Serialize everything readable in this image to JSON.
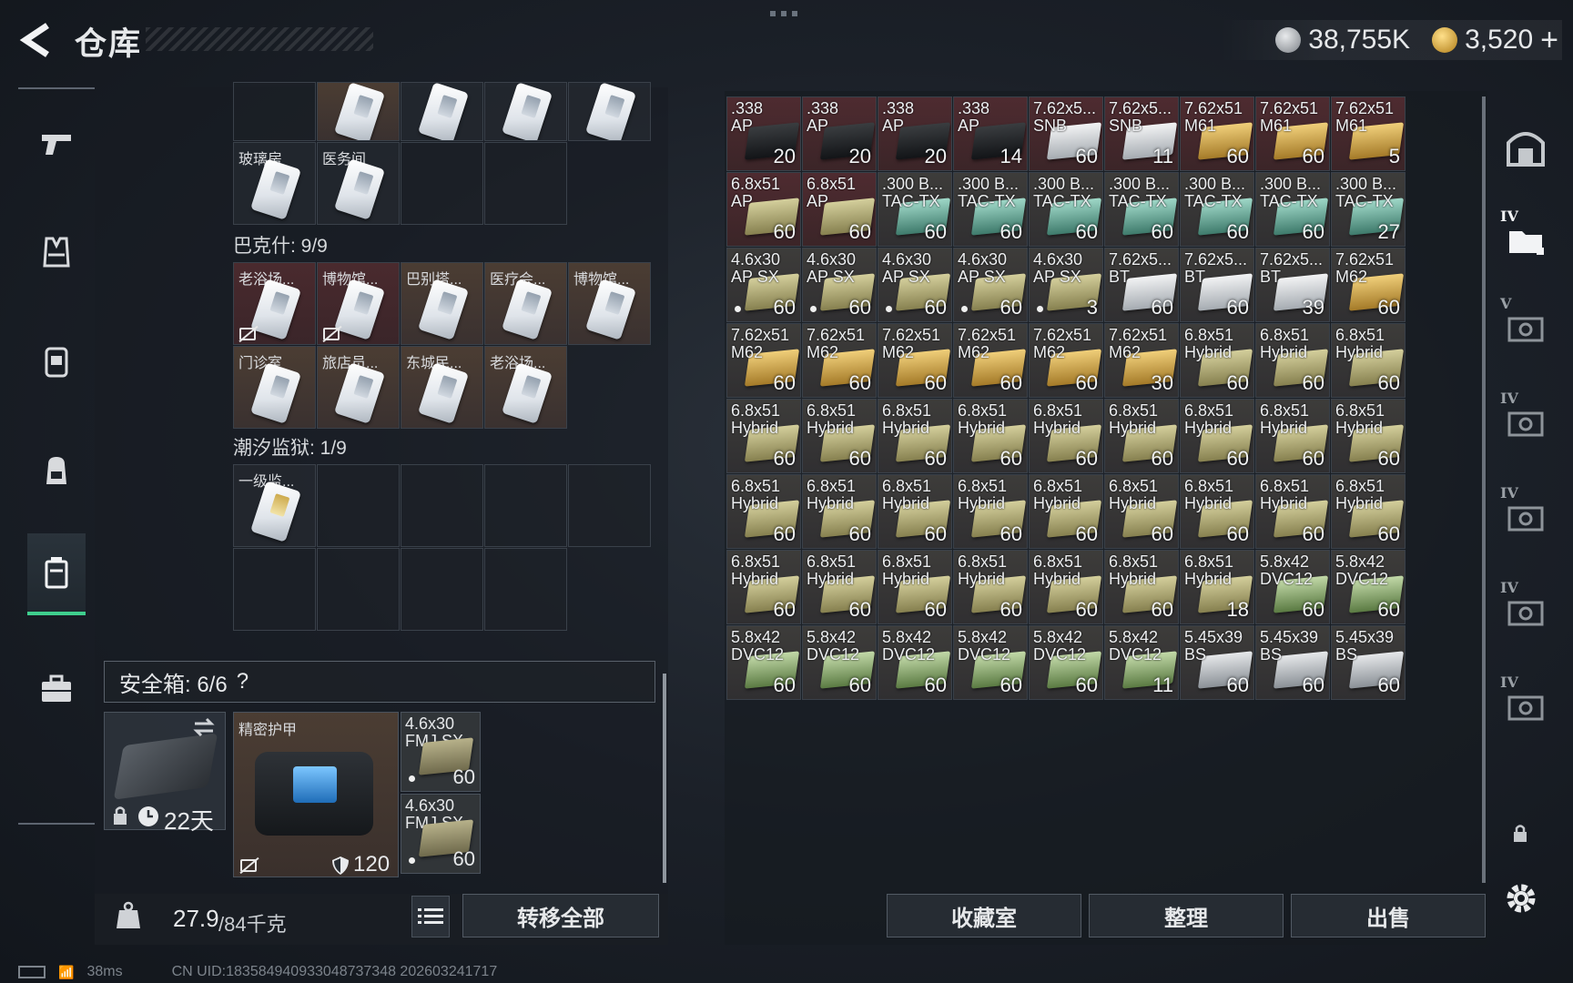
{
  "header": {
    "title": "仓库",
    "currency": [
      {
        "name": "silver-coin",
        "value": "38,755K",
        "color": "#c7cacd"
      },
      {
        "name": "gold-coin",
        "value": "3,520",
        "color": "#e0a93a"
      }
    ],
    "add_label": "+"
  },
  "left_rail": {
    "items": [
      {
        "icon": "pistol-icon"
      },
      {
        "icon": "vest-icon"
      },
      {
        "icon": "helmet-icon"
      },
      {
        "icon": "backpack-icon"
      },
      {
        "icon": "container-icon",
        "active": true
      },
      {
        "icon": "briefcase-icon"
      }
    ]
  },
  "key_cases": {
    "top_cards": [
      "",
      "",
      "",
      ""
    ],
    "row_a": [
      "玻璃房",
      "医务间"
    ],
    "bakesh_title": "巴克什: 9/9",
    "bakesh_row1": [
      "老浴场...",
      "博物馆...",
      "巴别塔...",
      "医疗会...",
      "博物馆..."
    ],
    "bakesh_row2": [
      "门诊室",
      "旅店员...",
      "东城民...",
      "老浴场..."
    ],
    "prison_title": "潮汐监狱: 1/9",
    "prison_items": [
      "一级监..."
    ]
  },
  "secure_box": {
    "label": "安全箱: 6/6",
    "help": "?",
    "case_days": "22天",
    "armor_name": "精密护甲",
    "armor_value": "120",
    "ammo": [
      {
        "l1": "4.6x30",
        "l2": "FMJ SX",
        "qty": "60"
      },
      {
        "l1": "4.6x30",
        "l2": "FMJ SX",
        "qty": "60"
      }
    ]
  },
  "weight": {
    "current": "27.9",
    "max": "/84千克"
  },
  "transfer_all": "转移全部",
  "inventory": [
    {
      "l1": ".338",
      "l2": "AP",
      "q": "20",
      "bg": "red",
      "box": "dark"
    },
    {
      "l1": ".338",
      "l2": "AP",
      "q": "20",
      "bg": "red",
      "box": "dark"
    },
    {
      "l1": ".338",
      "l2": "AP",
      "q": "20",
      "bg": "red",
      "box": "dark"
    },
    {
      "l1": ".338",
      "l2": "AP",
      "q": "14",
      "bg": "red",
      "box": "dark"
    },
    {
      "l1": "7.62x5...",
      "l2": "SNB",
      "q": "60",
      "bg": "red",
      "box": "white"
    },
    {
      "l1": "7.62x5...",
      "l2": "SNB",
      "q": "11",
      "bg": "red",
      "box": "white"
    },
    {
      "l1": "7.62x51",
      "l2": "M61",
      "q": "60",
      "bg": "red",
      "box": "gold"
    },
    {
      "l1": "7.62x51",
      "l2": "M61",
      "q": "60",
      "bg": "red",
      "box": "gold"
    },
    {
      "l1": "7.62x51",
      "l2": "M61",
      "q": "5",
      "bg": "red",
      "box": "gold"
    },
    {
      "l1": "6.8x51",
      "l2": "AP",
      "q": "60",
      "bg": "red",
      "box": "khaki"
    },
    {
      "l1": "6.8x51",
      "l2": "AP",
      "q": "60",
      "bg": "red",
      "box": "khaki"
    },
    {
      "l1": ".300 B...",
      "l2": "TAC-TX",
      "q": "60",
      "bg": "grey",
      "box": "teal"
    },
    {
      "l1": ".300 B...",
      "l2": "TAC-TX",
      "q": "60",
      "bg": "grey",
      "box": "teal"
    },
    {
      "l1": ".300 B...",
      "l2": "TAC-TX",
      "q": "60",
      "bg": "grey",
      "box": "teal"
    },
    {
      "l1": ".300 B...",
      "l2": "TAC-TX",
      "q": "60",
      "bg": "grey",
      "box": "teal"
    },
    {
      "l1": ".300 B...",
      "l2": "TAC-TX",
      "q": "60",
      "bg": "grey",
      "box": "teal"
    },
    {
      "l1": ".300 B...",
      "l2": "TAC-TX",
      "q": "60",
      "bg": "grey",
      "box": "teal"
    },
    {
      "l1": ".300 B...",
      "l2": "TAC-TX",
      "q": "27",
      "bg": "grey",
      "box": "teal"
    },
    {
      "l1": "4.6x30",
      "l2": "AP SX",
      "q": "60",
      "bg": "grey",
      "box": "khaki",
      "dot": true
    },
    {
      "l1": "4.6x30",
      "l2": "AP SX",
      "q": "60",
      "bg": "grey",
      "box": "khaki",
      "dot": true
    },
    {
      "l1": "4.6x30",
      "l2": "AP SX",
      "q": "60",
      "bg": "grey",
      "box": "khaki",
      "dot": true
    },
    {
      "l1": "4.6x30",
      "l2": "AP SX",
      "q": "60",
      "bg": "grey",
      "box": "khaki",
      "dot": true
    },
    {
      "l1": "4.6x30",
      "l2": "AP SX",
      "q": "3",
      "bg": "grey",
      "box": "khaki",
      "dot": true
    },
    {
      "l1": "7.62x5...",
      "l2": "BT",
      "q": "60",
      "bg": "grey",
      "box": "white"
    },
    {
      "l1": "7.62x5...",
      "l2": "BT",
      "q": "60",
      "bg": "grey",
      "box": "white"
    },
    {
      "l1": "7.62x5...",
      "l2": "BT",
      "q": "39",
      "bg": "grey",
      "box": "white"
    },
    {
      "l1": "7.62x51",
      "l2": "M62",
      "q": "60",
      "bg": "grey",
      "box": "gold"
    },
    {
      "l1": "7.62x51",
      "l2": "M62",
      "q": "60",
      "bg": "grey",
      "box": "gold"
    },
    {
      "l1": "7.62x51",
      "l2": "M62",
      "q": "60",
      "bg": "grey",
      "box": "gold"
    },
    {
      "l1": "7.62x51",
      "l2": "M62",
      "q": "60",
      "bg": "grey",
      "box": "gold"
    },
    {
      "l1": "7.62x51",
      "l2": "M62",
      "q": "60",
      "bg": "grey",
      "box": "gold"
    },
    {
      "l1": "7.62x51",
      "l2": "M62",
      "q": "60",
      "bg": "grey",
      "box": "gold"
    },
    {
      "l1": "7.62x51",
      "l2": "M62",
      "q": "30",
      "bg": "grey",
      "box": "gold"
    },
    {
      "l1": "6.8x51",
      "l2": "Hybrid",
      "q": "60",
      "bg": "grey",
      "box": "khaki"
    },
    {
      "l1": "6.8x51",
      "l2": "Hybrid",
      "q": "60",
      "bg": "grey",
      "box": "khaki"
    },
    {
      "l1": "6.8x51",
      "l2": "Hybrid",
      "q": "60",
      "bg": "grey",
      "box": "khaki"
    },
    {
      "l1": "6.8x51",
      "l2": "Hybrid",
      "q": "60",
      "bg": "grey",
      "box": "khaki"
    },
    {
      "l1": "6.8x51",
      "l2": "Hybrid",
      "q": "60",
      "bg": "grey",
      "box": "khaki"
    },
    {
      "l1": "6.8x51",
      "l2": "Hybrid",
      "q": "60",
      "bg": "grey",
      "box": "khaki"
    },
    {
      "l1": "6.8x51",
      "l2": "Hybrid",
      "q": "60",
      "bg": "grey",
      "box": "khaki"
    },
    {
      "l1": "6.8x51",
      "l2": "Hybrid",
      "q": "60",
      "bg": "grey",
      "box": "khaki"
    },
    {
      "l1": "6.8x51",
      "l2": "Hybrid",
      "q": "60",
      "bg": "grey",
      "box": "khaki"
    },
    {
      "l1": "6.8x51",
      "l2": "Hybrid",
      "q": "60",
      "bg": "grey",
      "box": "khaki"
    },
    {
      "l1": "6.8x51",
      "l2": "Hybrid",
      "q": "60",
      "bg": "grey",
      "box": "khaki"
    },
    {
      "l1": "6.8x51",
      "l2": "Hybrid",
      "q": "60",
      "bg": "grey",
      "box": "khaki"
    },
    {
      "l1": "6.8x51",
      "l2": "Hybrid",
      "q": "60",
      "bg": "grey",
      "box": "khaki"
    },
    {
      "l1": "6.8x51",
      "l2": "Hybrid",
      "q": "60",
      "bg": "grey",
      "box": "khaki"
    },
    {
      "l1": "6.8x51",
      "l2": "Hybrid",
      "q": "60",
      "bg": "grey",
      "box": "khaki"
    },
    {
      "l1": "6.8x51",
      "l2": "Hybrid",
      "q": "60",
      "bg": "grey",
      "box": "khaki"
    },
    {
      "l1": "6.8x51",
      "l2": "Hybrid",
      "q": "60",
      "bg": "grey",
      "box": "khaki"
    },
    {
      "l1": "6.8x51",
      "l2": "Hybrid",
      "q": "60",
      "bg": "grey",
      "box": "khaki"
    },
    {
      "l1": "6.8x51",
      "l2": "Hybrid",
      "q": "60",
      "bg": "grey",
      "box": "khaki"
    },
    {
      "l1": "6.8x51",
      "l2": "Hybrid",
      "q": "60",
      "bg": "grey",
      "box": "khaki"
    },
    {
      "l1": "6.8x51",
      "l2": "Hybrid",
      "q": "60",
      "bg": "grey",
      "box": "khaki"
    },
    {
      "l1": "6.8x51",
      "l2": "Hybrid",
      "q": "60",
      "bg": "grey",
      "box": "khaki"
    },
    {
      "l1": "6.8x51",
      "l2": "Hybrid",
      "q": "60",
      "bg": "grey",
      "box": "khaki"
    },
    {
      "l1": "6.8x51",
      "l2": "Hybrid",
      "q": "60",
      "bg": "grey",
      "box": "khaki"
    },
    {
      "l1": "6.8x51",
      "l2": "Hybrid",
      "q": "60",
      "bg": "grey",
      "box": "khaki"
    },
    {
      "l1": "6.8x51",
      "l2": "Hybrid",
      "q": "60",
      "bg": "grey",
      "box": "khaki"
    },
    {
      "l1": "6.8x51",
      "l2": "Hybrid",
      "q": "60",
      "bg": "grey",
      "box": "khaki"
    },
    {
      "l1": "6.8x51",
      "l2": "Hybrid",
      "q": "18",
      "bg": "grey",
      "box": "khaki"
    },
    {
      "l1": "5.8x42",
      "l2": "DVC12",
      "q": "60",
      "bg": "grey",
      "box": "green"
    },
    {
      "l1": "5.8x42",
      "l2": "DVC12",
      "q": "60",
      "bg": "grey",
      "box": "green"
    },
    {
      "l1": "5.8x42",
      "l2": "DVC12",
      "q": "60",
      "bg": "grey",
      "box": "green"
    },
    {
      "l1": "5.8x42",
      "l2": "DVC12",
      "q": "60",
      "bg": "grey",
      "box": "green"
    },
    {
      "l1": "5.8x42",
      "l2": "DVC12",
      "q": "60",
      "bg": "grey",
      "box": "green"
    },
    {
      "l1": "5.8x42",
      "l2": "DVC12",
      "q": "60",
      "bg": "grey",
      "box": "green"
    },
    {
      "l1": "5.8x42",
      "l2": "DVC12",
      "q": "60",
      "bg": "grey",
      "box": "green"
    },
    {
      "l1": "5.8x42",
      "l2": "DVC12",
      "q": "11",
      "bg": "grey",
      "box": "green"
    },
    {
      "l1": "5.45x39",
      "l2": "BS",
      "q": "60",
      "bg": "grey",
      "box": "silver"
    },
    {
      "l1": "5.45x39",
      "l2": "BS",
      "q": "60",
      "bg": "grey",
      "box": "silver"
    },
    {
      "l1": "5.45x39",
      "l2": "BS",
      "q": "60",
      "bg": "grey",
      "box": "silver"
    }
  ],
  "bottom_actions": [
    {
      "name": "collection-room-button",
      "label": "收藏室"
    },
    {
      "name": "sort-button",
      "label": "整理"
    },
    {
      "name": "sell-button",
      "label": "出售"
    }
  ],
  "right_rail": [
    {
      "icon": "storage-main-icon",
      "label": ""
    },
    {
      "icon": "storage-tab-4-active-icon",
      "label": "IV"
    },
    {
      "icon": "storage-tab-5-icon",
      "label": "V"
    },
    {
      "icon": "storage-tab-4a-icon",
      "label": "IV"
    },
    {
      "icon": "storage-tab-4b-icon",
      "label": "IV"
    },
    {
      "icon": "storage-tab-4c-icon",
      "label": "IV"
    },
    {
      "icon": "storage-tab-4d-icon",
      "label": "IV"
    }
  ],
  "footer": {
    "ping": "38ms",
    "uid": "CN UID:1835849409330487373​48 202603241717"
  },
  "colors": {
    "accent": "#3fcf8e",
    "red_cell": "#4a2a2e",
    "tan_cell": "#4b3d33"
  }
}
